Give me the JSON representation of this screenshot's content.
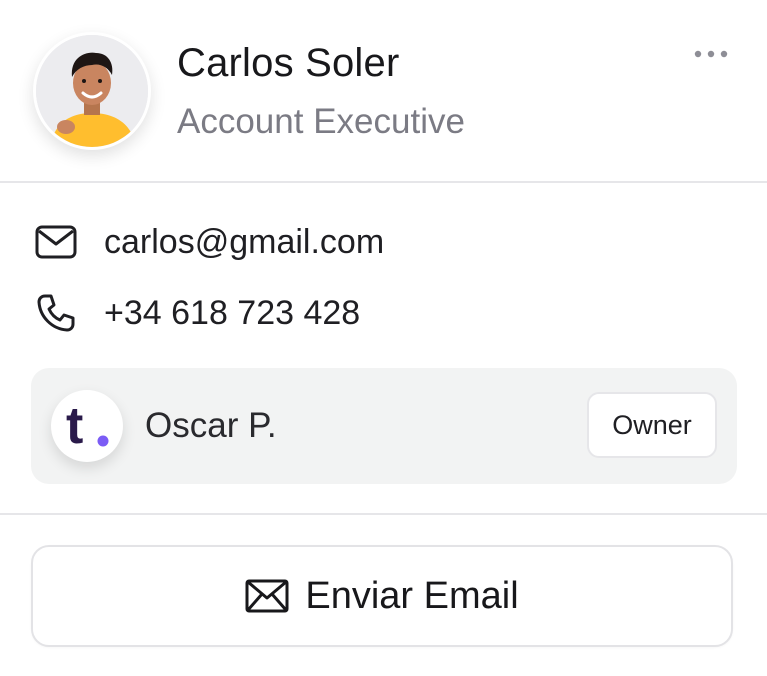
{
  "profile": {
    "name": "Carlos Soler",
    "role": "Account Executive",
    "avatar_icon": "person-photo-avatar",
    "more_icon": "more-horizontal-icon"
  },
  "contact": {
    "email": "carlos@gmail.com",
    "email_icon": "mail-icon",
    "phone": "+34 618 723 428",
    "phone_icon": "phone-icon"
  },
  "owner": {
    "name": "Oscar P.",
    "badge": "Owner",
    "logo_icon": "t-logo-icon",
    "logo_letter": "t",
    "logo_color": "#2a1a4a",
    "logo_dot_color": "#7b5cf5"
  },
  "actions": {
    "send_email_label": "Enviar Email",
    "send_email_icon": "envelope-icon"
  },
  "colors": {
    "text_primary": "#18181b",
    "text_secondary": "#7b7b84",
    "divider": "#e6e6e9",
    "owner_bg": "#f2f3f3",
    "avatar_shirt": "#ffbe2e"
  }
}
